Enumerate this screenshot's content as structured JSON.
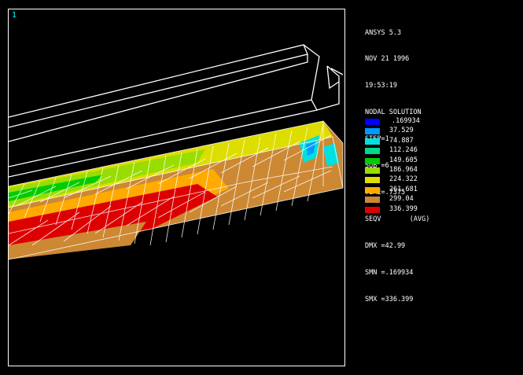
{
  "window_number": "1",
  "header": {
    "product": "ANSYS 5.3",
    "date": "NOV 21 1996",
    "time": "19:53:19",
    "solution_type": "NODAL SOLUTION",
    "step": "STEP=1",
    "sub": "SUB =6",
    "time_value": "TIME=.7375",
    "item_label": "SEQV",
    "avg_label": "(AVG)",
    "dmx": "DMX =42.99",
    "smn": "SMN =.169934",
    "smx": "SMX =336.399"
  },
  "legend": [
    {
      "value": ".169934",
      "color": "#0000ff"
    },
    {
      "value": "37.529",
      "color": "#0099ff"
    },
    {
      "value": "74.887",
      "color": "#00e0e0"
    },
    {
      "value": "112.246",
      "color": "#00d890"
    },
    {
      "value": "149.605",
      "color": "#00cc00"
    },
    {
      "value": "186.964",
      "color": "#99dd00"
    },
    {
      "value": "224.322",
      "color": "#dddd00"
    },
    {
      "value": "261.681",
      "color": "#ffaa00"
    },
    {
      "value": "299.04",
      "color": "#cc8833"
    },
    {
      "value": "336.399",
      "color": "#dd0000"
    }
  ]
}
